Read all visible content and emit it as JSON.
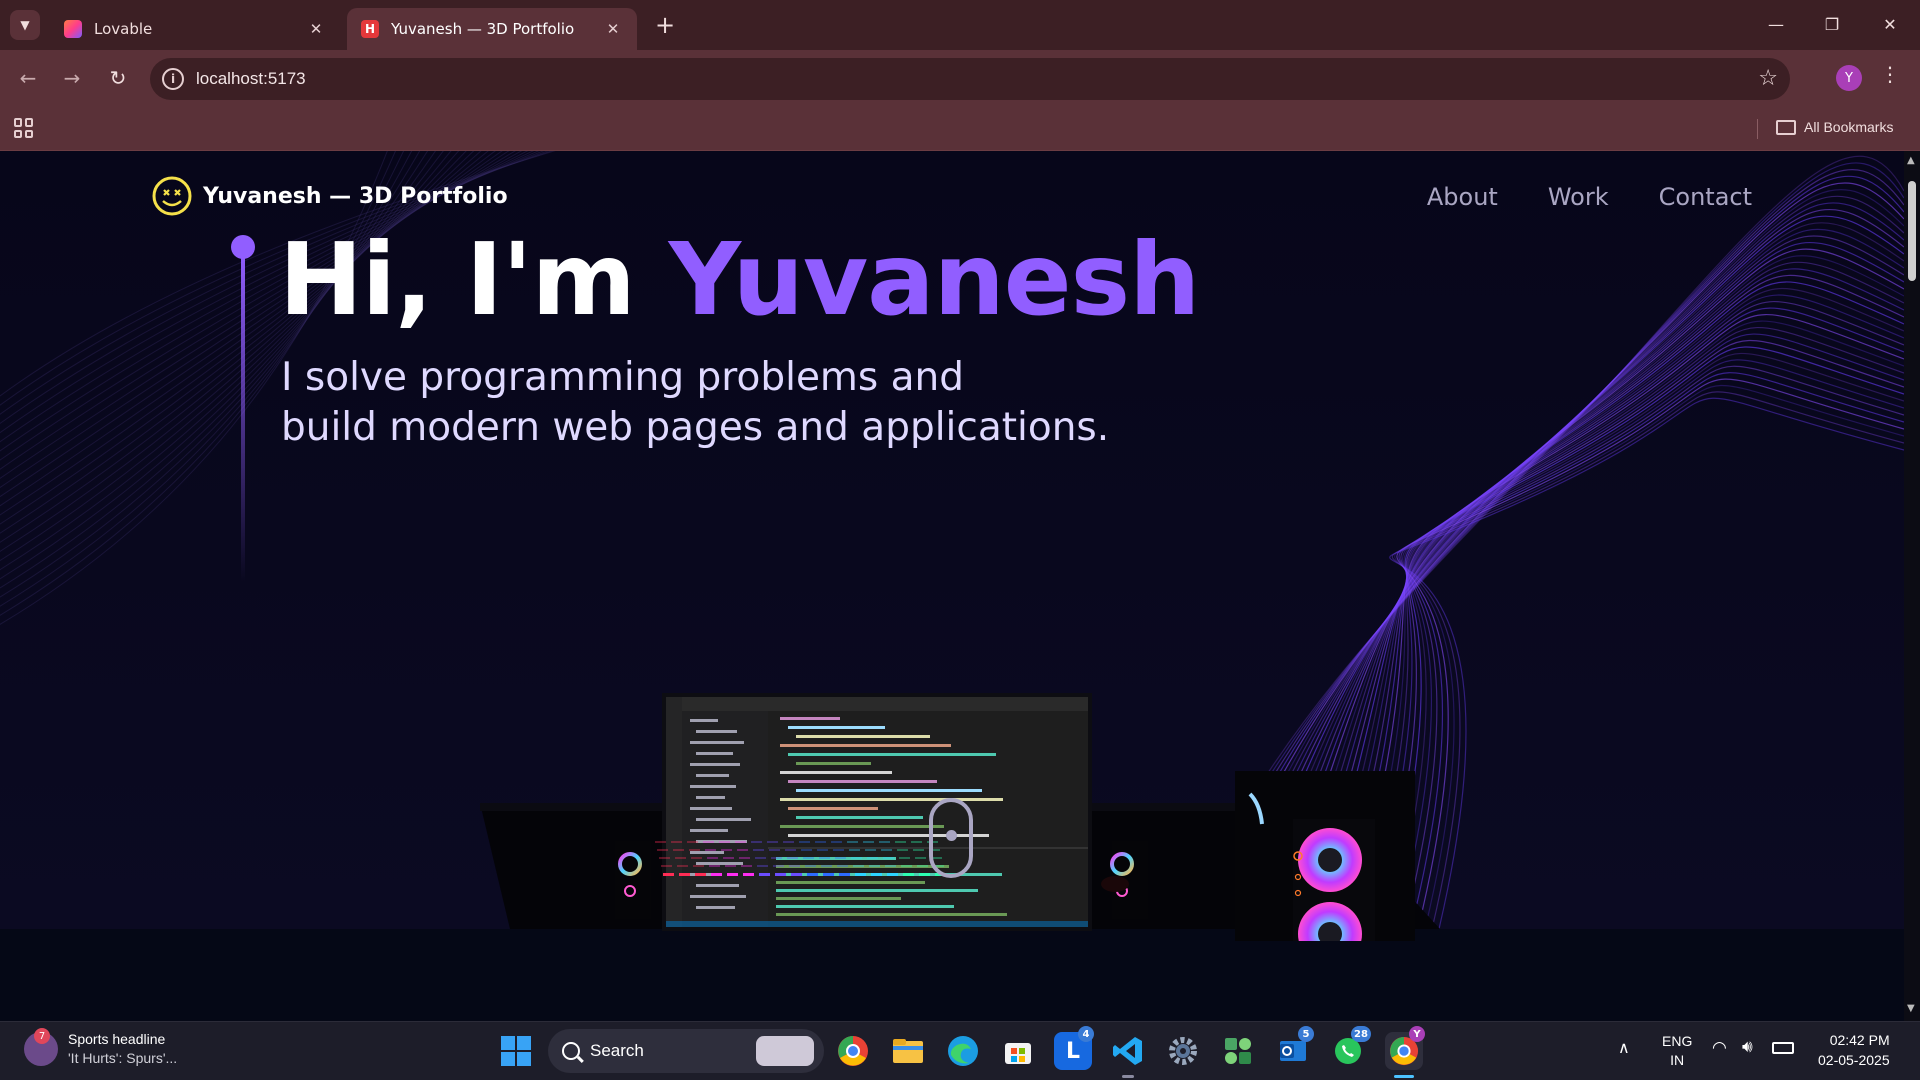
{
  "browser": {
    "tabs": [
      {
        "title": "Lovable",
        "active": false,
        "favicon_color": "#ff5a7a"
      },
      {
        "title": "Yuvanesh — 3D Portfolio",
        "active": true,
        "favicon_color": "#e5383b"
      }
    ],
    "url": "localhost:5173",
    "profile_initial": "Y",
    "bookmarks_label": "All Bookmarks"
  },
  "page": {
    "logo_text": "Yuvanesh — 3D Portfolio",
    "nav": [
      {
        "label": "About"
      },
      {
        "label": "Work"
      },
      {
        "label": "Contact"
      }
    ],
    "hero": {
      "greeting": "Hi, I'm ",
      "name": "Yuvanesh",
      "subtitle_line1": "I solve programming problems and",
      "subtitle_line2": "build modern web pages and applications."
    },
    "colors": {
      "background": "#050816",
      "accent": "#915eff",
      "nav_text": "#aaa6c3"
    }
  },
  "taskbar": {
    "widget": {
      "title": "Sports headline",
      "subtitle": "'It Hurts': Spurs'...",
      "badge": "7"
    },
    "search_label": "Search",
    "apps": [
      {
        "name": "chrome-icon",
        "badge": ""
      },
      {
        "name": "file-explorer-icon",
        "badge": ""
      },
      {
        "name": "edge-icon",
        "badge": ""
      },
      {
        "name": "store-icon",
        "badge": ""
      },
      {
        "name": "lens-icon",
        "badge": "4"
      },
      {
        "name": "vscode-icon",
        "badge": ""
      },
      {
        "name": "settings-icon",
        "badge": ""
      },
      {
        "name": "teams-icon",
        "badge": ""
      },
      {
        "name": "outlook-icon",
        "badge": "5"
      },
      {
        "name": "whatsapp-icon",
        "badge": "28"
      },
      {
        "name": "chrome-profile-icon",
        "badge": "Y"
      }
    ],
    "language": "ENG",
    "region": "IN",
    "time": "02:42 PM",
    "date": "02-05-2025"
  }
}
